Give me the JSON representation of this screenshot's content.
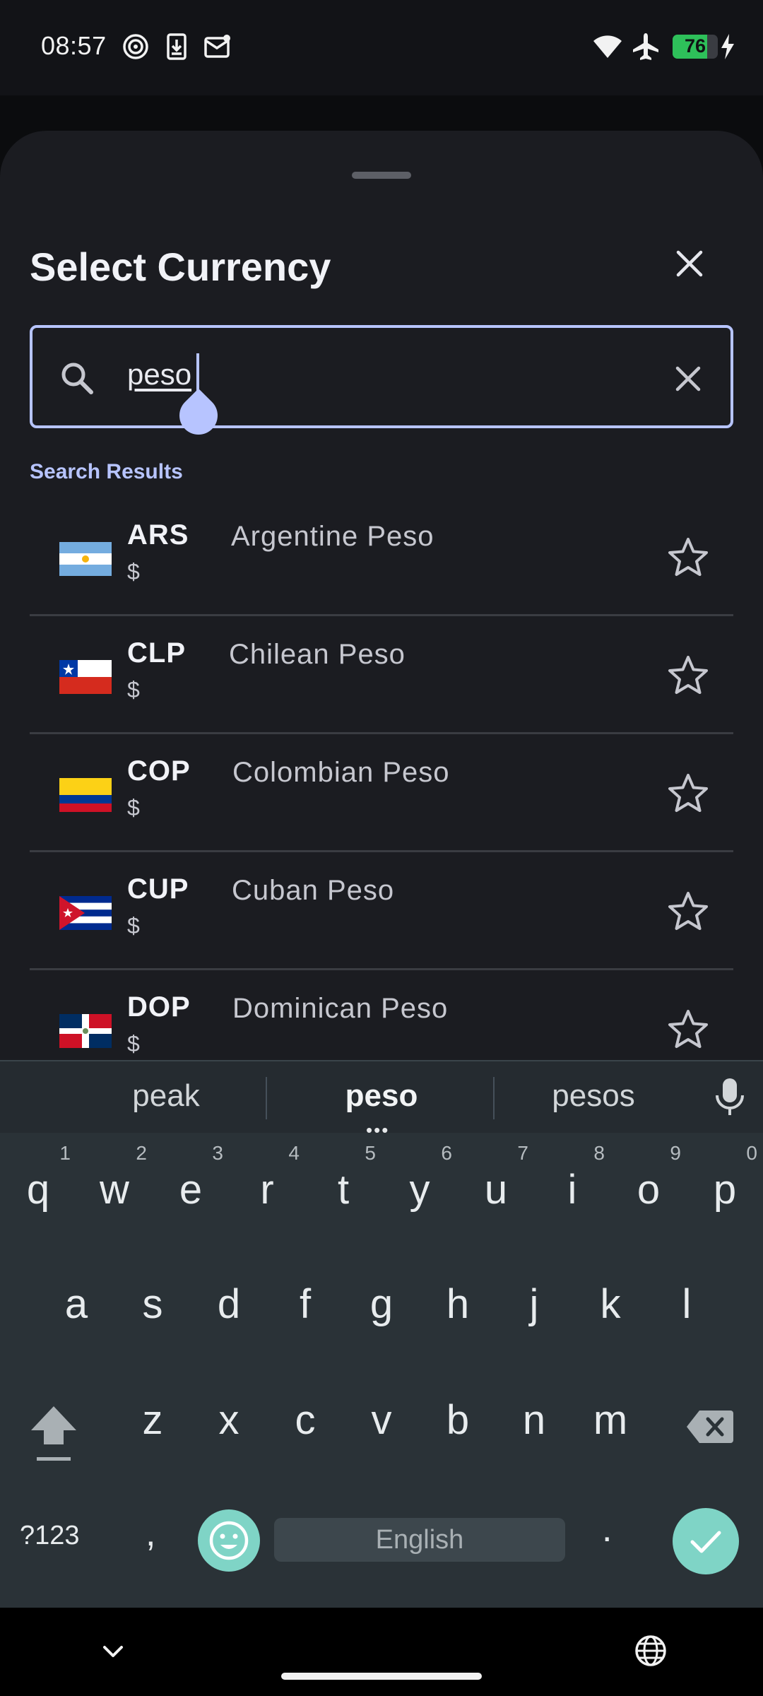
{
  "status_bar": {
    "time": "08:57",
    "left_icons": [
      "hotspot-icon",
      "download-icon",
      "mail-icon"
    ],
    "right_icons": [
      "wifi-icon",
      "airplane-icon",
      "battery-icon",
      "charging-bolt-icon"
    ],
    "battery_level": "76",
    "battery_fraction": 0.76
  },
  "sheet": {
    "title": "Select Currency",
    "search": {
      "value": "peso",
      "accent_color": "#b7c4ff"
    },
    "section_label": "Search Results",
    "results": [
      {
        "code": "ARS",
        "name": "Argentine Peso",
        "symbol": "$",
        "flag": "argentina-flag-icon"
      },
      {
        "code": "CLP",
        "name": "Chilean Peso",
        "symbol": "$",
        "flag": "chile-flag-icon"
      },
      {
        "code": "COP",
        "name": "Colombian Peso",
        "symbol": "$",
        "flag": "colombia-flag-icon"
      },
      {
        "code": "CUP",
        "name": "Cuban Peso",
        "symbol": "$",
        "flag": "cuba-flag-icon"
      },
      {
        "code": "DOP",
        "name": "Dominican Peso",
        "symbol": "$",
        "flag": "dominican-republic-flag-icon"
      }
    ]
  },
  "keyboard": {
    "suggestions": [
      "peak",
      "peso",
      "pesos"
    ],
    "active_suggestion": "peso",
    "row1": [
      {
        "key": "q",
        "hint": "1"
      },
      {
        "key": "w",
        "hint": "2"
      },
      {
        "key": "e",
        "hint": "3"
      },
      {
        "key": "r",
        "hint": "4"
      },
      {
        "key": "t",
        "hint": "5"
      },
      {
        "key": "y",
        "hint": "6"
      },
      {
        "key": "u",
        "hint": "7"
      },
      {
        "key": "i",
        "hint": "8"
      },
      {
        "key": "o",
        "hint": "9"
      },
      {
        "key": "p",
        "hint": "0"
      }
    ],
    "row2": [
      "a",
      "s",
      "d",
      "f",
      "g",
      "h",
      "j",
      "k",
      "l"
    ],
    "row3": [
      "z",
      "x",
      "c",
      "v",
      "b",
      "n",
      "m"
    ],
    "symbols_label": "?123",
    "comma": ",",
    "period": ".",
    "space_label": "English",
    "accent_color": "#7fd4c6"
  }
}
